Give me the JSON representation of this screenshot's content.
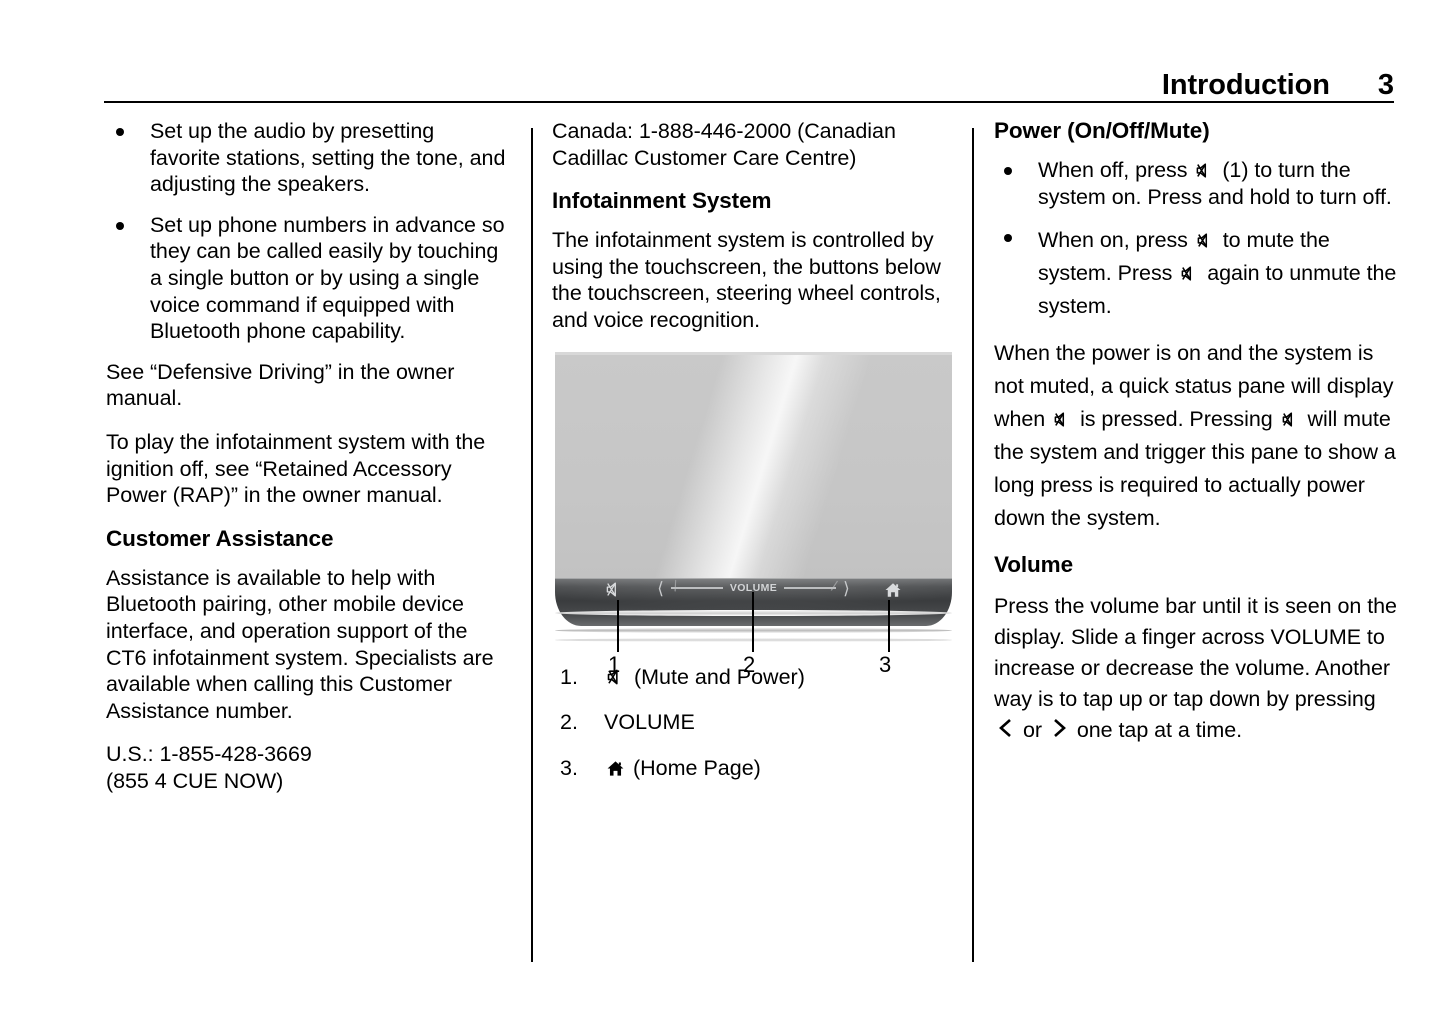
{
  "header": {
    "title": "Introduction",
    "page_number": "3"
  },
  "columns": {
    "col1": {
      "bullets": [
        "Set up the audio by presetting favorite stations, setting the tone, and adjusting the speakers.",
        "Set up phone numbers in advance so they can be called easily by touching a single button or by using a single voice command if equipped with Bluetooth phone capability."
      ],
      "para_defensive_driving": "See “Defensive Driving” in the owner manual.",
      "para_retained_accessory": "To play the infotainment system with the ignition off, see “Retained Accessory Power (RAP)” in the owner manual.",
      "heading_customer_assistance": "Customer Assistance",
      "para_assistance": "Assistance is available to help with Bluetooth pairing, other mobile device interface, and operation support of the CT6 infotainment system. Specialists are available when calling this Customer Assistance number.",
      "phone_us_line1": "U.S.: 1-855-428-3669",
      "phone_us_line2": "(855 4 CUE NOW)"
    },
    "col2": {
      "phone_canada_line1": "Canada: 1-888-446-2000 (Canadian",
      "phone_canada_line2": "Cadillac Customer Care Centre)",
      "heading_infotainment_system": "Infotainment System",
      "para_controlled_by": "The infotainment system is controlled by using the touchscreen, the buttons below the touchscreen, steering wheel controls, and voice recognition.",
      "figure": {
        "bezel_volume_label": "VOLUME",
        "bezel_left_chevron": "‹",
        "bezel_right_chevron": "›",
        "bezel_mute_icon": "mute-icon",
        "bezel_home_icon": "home-icon",
        "callouts": [
          "1",
          "2",
          "3"
        ]
      },
      "legend": [
        {
          "num": "1.",
          "icon": "mute-icon",
          "label": "(Mute and Power)"
        },
        {
          "num": "2.",
          "icon": "",
          "label": "VOLUME"
        },
        {
          "num": "3.",
          "icon": "home-icon",
          "label": "(Home Page)"
        }
      ]
    },
    "col3": {
      "heading_power": "Power (On/Off/Mute)",
      "bullet1_a": "When off, press",
      "bullet1_b": "(1) to turn the system on. Press and hold to turn off.",
      "bullet2_a": "When on, press",
      "bullet2_b": "to mute the system. Press",
      "bullet2_c": "again to unmute the system.",
      "para_status_a": "When the power is on and the system is not muted, a quick status pane will display when",
      "para_status_b": "is pressed. Pressing",
      "para_status_c": "will mute the system and trigger this pane to show a long press is required to actually power down the system.",
      "heading_volume": "Volume",
      "para_volume_a": "Press the volume bar until it is seen on the display. Slide a finger across VOLUME to increase or decrease the volume. Another way is to tap up or tap down by pressing",
      "para_volume_or": "or",
      "para_volume_b": "one tap at a time."
    }
  },
  "icons": {
    "mute": "mute-icon",
    "home": "home-icon",
    "chevron_left": "chevron-left-icon",
    "chevron_right": "chevron-right-icon"
  }
}
